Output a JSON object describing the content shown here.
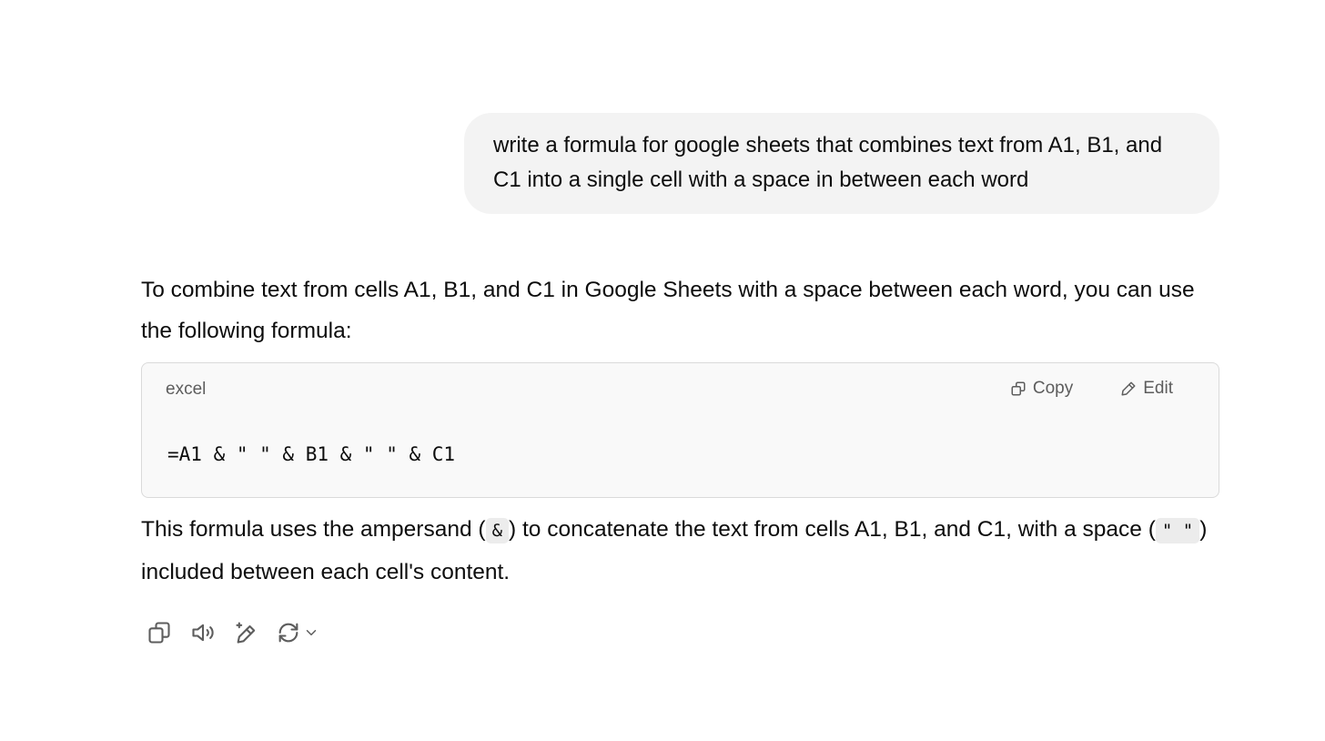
{
  "user_message": {
    "text": "write a formula for google sheets that combines text from A1, B1, and C1 into a single cell with a space in between each word"
  },
  "assistant": {
    "intro": "To combine text from cells A1, B1, and C1 in Google Sheets with a space between each word, you can use the following formula:",
    "code_block": {
      "language": "excel",
      "copy_label": "Copy",
      "edit_label": "Edit",
      "code": "=A1 & \" \" & B1 & \" \" & C1"
    },
    "explanation": {
      "part1": "This formula uses the ampersand (",
      "code1": "&",
      "part2": ") to concatenate the text from cells A1, B1, and C1, with a space (",
      "code2": "\" \"",
      "part3": ") included between each cell's content."
    }
  },
  "toolbar": {
    "icons": [
      "copy-icon",
      "read-aloud-icon",
      "edit-icon",
      "regenerate-icon",
      "chevron-down-icon"
    ]
  }
}
